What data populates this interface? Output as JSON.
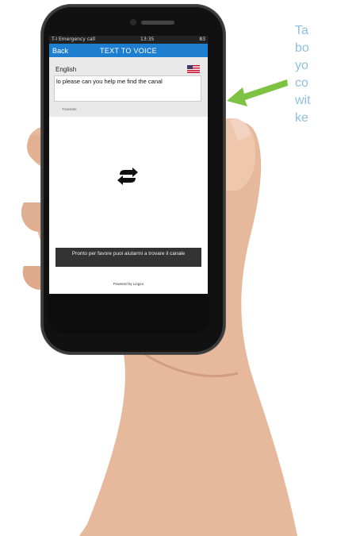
{
  "status_bar": {
    "left": "T-I Emergency call",
    "time": "13:35",
    "right": "83"
  },
  "app_bar": {
    "back_label": "Back",
    "title": "TEXT TO VOICE"
  },
  "source": {
    "language": "English",
    "text": "lo please can you help me find the canal",
    "translate_label": "Translate"
  },
  "result": {
    "text": "Pronto per favore puoi aiutarmi a trovare il canale"
  },
  "footer": {
    "powered_by": "Powered by Lingvo"
  },
  "annotation": {
    "lines": [
      "Ta",
      "bo",
      "yo",
      "co",
      "wit",
      "ke"
    ]
  },
  "icons": {
    "swap": "swap-icon",
    "flag": "us-flag-icon",
    "arrow": "pointer-arrow"
  },
  "colors": {
    "app_bar": "#1e7fd0",
    "arrow": "#7dc242",
    "note_text": "#8fc0df"
  }
}
